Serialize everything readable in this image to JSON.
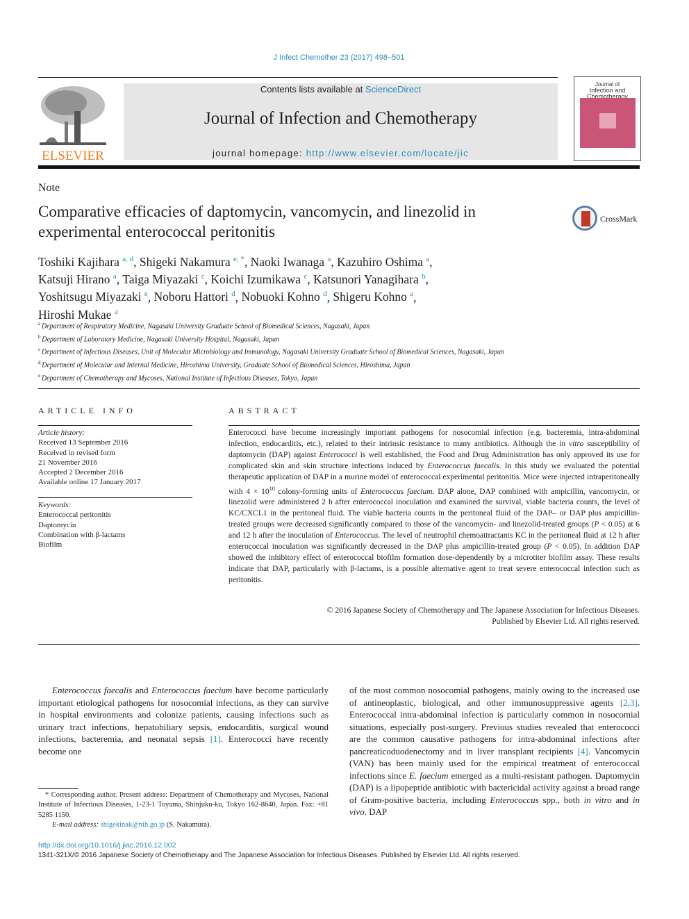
{
  "header": {
    "citation": "J Infect Chemother 23 (2017) 498–501",
    "contents_prefix": "Contents lists available at ",
    "contents_link": "ScienceDirect",
    "journal_title": "Journal of Infection and Chemotherapy",
    "homepage_prefix": "journal homepage: ",
    "homepage_url": "http://www.elsevier.com/locate/jic",
    "publisher_logo": "ELSEVIER",
    "cover_title": "Infection and Chemotherapy",
    "cover_top": "Journal of",
    "colors": {
      "link": "#2a8ab8",
      "elsevier_orange": "#f47a20",
      "cover_pink": "#c95677"
    }
  },
  "article": {
    "type": "Note",
    "title": "Comparative efficacies of daptomycin, vancomycin, and linezolid in experimental enterococcal peritonitis",
    "crossmark_label": "CrossMark",
    "authors": [
      {
        "name": "Toshiki Kajihara",
        "sup": "a, d"
      },
      {
        "name": "Shigeki Nakamura",
        "sup": "e, *"
      },
      {
        "name": "Naoki Iwanaga",
        "sup": "a"
      },
      {
        "name": "Kazuhiro Oshima",
        "sup": "a"
      },
      {
        "name": "Katsuji Hirano",
        "sup": "a"
      },
      {
        "name": "Taiga Miyazaki",
        "sup": "c"
      },
      {
        "name": "Koichi Izumikawa",
        "sup": "c"
      },
      {
        "name": "Katsunori Yanagihara",
        "sup": "b"
      },
      {
        "name": "Yoshitsugu Miyazaki",
        "sup": "e"
      },
      {
        "name": "Noboru Hattori",
        "sup": "d"
      },
      {
        "name": "Nobuoki Kohno",
        "sup": "d"
      },
      {
        "name": "Shigeru Kohno",
        "sup": "a"
      },
      {
        "name": "Hiroshi Mukae",
        "sup": "a"
      }
    ],
    "affiliations": [
      {
        "key": "a",
        "text": "Department of Respiratory Medicine, Nagasaki University Graduate School of Biomedical Sciences, Nagasaki, Japan"
      },
      {
        "key": "b",
        "text": "Department of Laboratory Medicine, Nagasaki University Hospital, Nagasaki, Japan"
      },
      {
        "key": "c",
        "text": "Department of Infectious Diseases, Unit of Molecular Microbiology and Immunology, Nagasaki University Graduate School of Biomedical Sciences, Nagasaki, Japan"
      },
      {
        "key": "d",
        "text": "Department of Molecular and Internal Medicine, Hiroshima University, Graduate School of Biomedical Sciences, Hiroshima, Japan"
      },
      {
        "key": "e",
        "text": "Department of Chemotherapy and Mycoses, National Institute of Infectious Diseases, Tokyo, Japan"
      }
    ]
  },
  "article_info": {
    "heading": "ARTICLE INFO",
    "history_label": "Article history:",
    "history": [
      "Received 13 September 2016",
      "Received in revised form",
      "21 November 2016",
      "Accepted 2 December 2016",
      "Available online 17 January 2017"
    ],
    "keywords_label": "Keywords:",
    "keywords": [
      "Enterococcal peritonitis",
      "Daptomycin",
      "Combination with β-lactams",
      "Biofilm"
    ]
  },
  "abstract": {
    "heading": "ABSTRACT",
    "p1": "Enterococci have become increasingly important pathogens for nosocomial infection (e.g. bacteremia, intra-abdominal infection, endocarditis, etc.), related to their intrinsic resistance to many antibiotics. Although the ",
    "p1_i1": "in vitro",
    "p2": " susceptibility of daptomycin (DAP) against ",
    "p2_i": "Enterococci",
    "p3": " is well established, the Food and Drug Administration has only approved its use for complicated skin and skin structure infections induced by ",
    "p3_i": "Enterococcus faecalis",
    "p4": ". In this study we evaluated the potential therapeutic application of DAP in a murine model of enterococcal experimental peritonitis. Mice were injected intraperitoneally with 4 × 10",
    "p4_sup": "10",
    "p5": " colony-forming units of ",
    "p5_i": "Enterococcus faecium",
    "p6": ". DAP alone, DAP combined with ampicillin, vancomycin, or linezolid were administered 2 h after enterococcal inoculation and examined the survival, viable bacteria counts, the level of KC/CXCL1 in the peritoneal fluid. The viable bacteria counts in the peritoneal fluid of the DAP– or DAP plus ampicillin-treated groups were decreased significantly compared to those of the vancomycin- and linezolid-treated groups (",
    "p6_i": "P",
    "p7": " < 0.05) at 6 and 12 h after the inoculation of ",
    "p7_i": "Enterococcus",
    "p8": ". The level of neutrophil chemoattractants KC in the peritoneal fluid at 12 h after enterococcal inoculation was significantly decreased in the DAP plus ampicillin-treated group (",
    "p8_i": "P",
    "p9": " < 0.05). In addition DAP showed the inhibitory effect of enterococcal biofilm formation dose-dependently by a microtiter biofilm assay. These results indicate that DAP, particularly with β-lactams, is a possible alternative agent to treat severe enterococcal infection such as peritonitis.",
    "copyright_1": "© 2016 Japanese Society of Chemotherapy and The Japanese Association for Infectious Diseases.",
    "copyright_2": "Published by Elsevier Ltd. All rights reserved."
  },
  "body": {
    "left_i1": "Enterococcus faecalis",
    "left_t1": " and ",
    "left_i2": "Enterococcus faecium",
    "left_t2": " have become particularly important etiological pathogens for nosocomial infections, as they can survive in hospital environments and colonize patients, causing infections such as urinary tract infections, hepatobiliary sepsis, endocarditis, surgical wound infections, bacteremia, and neonatal sepsis ",
    "left_ref1": "[1]",
    "left_t3": ". Enterococci have recently become one",
    "right_t1": "of the most common nosocomial pathogens, mainly owing to the increased use of antineoplastic, biological, and other immunosuppressive agents ",
    "right_ref1": "[2,3]",
    "right_t2": ". Enterococcal intra-abdominal infection is particularly common in nosocomial situations, especially post-surgery. Previous studies revealed that enterococci are the common causative pathogens for intra-abdominal infections after pancreaticoduodenectomy and in liver transplant recipients ",
    "right_ref2": "[4]",
    "right_t3": ". Vancomycin (VAN) has been mainly used for the empirical treatment of enterococcal infections since ",
    "right_i1": "E. faecium",
    "right_t4": " emerged as a multi-resistant pathogen. Daptomycin (DAP) is a lipopeptide antibiotic with bactericidal activity against a broad range of Gram-positive bacteria, including ",
    "right_i2": "Enterococcus",
    "right_t5": " spp., both ",
    "right_i3": "in vitro",
    "right_t6": " and ",
    "right_i4": "in vivo",
    "right_t7": ". DAP"
  },
  "footnote": {
    "text": "* Corresponding author. Present address: Department of Chemotherapy and Mycoses, National Institute of Infectious Diseases, 1-23-1 Toyama, Shinjuku-ku, Tokyo 162-8640, Japan. Fax: +81 5285 1150.",
    "email_label": "E-mail address: ",
    "email": "shigekinak@nih.go.jp",
    "email_suffix": " (S. Nakamura)."
  },
  "footer": {
    "doi": "http://dx.doi.org/10.1016/j.jiac.2016.12.002",
    "issn_copyright": "1341-321X/© 2016 Japanese Society of Chemotherapy and The Japanese Association for Infectious Diseases. Published by Elsevier Ltd. All rights reserved."
  }
}
